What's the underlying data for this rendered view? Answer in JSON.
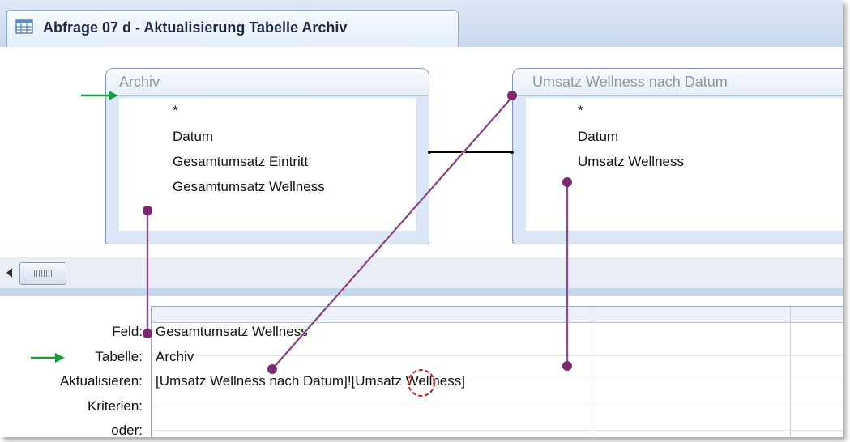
{
  "window": {
    "tab_title": "Abfrage 07 d - Aktualisierung Tabelle Archiv",
    "tab_icon": "query-icon"
  },
  "tables": [
    {
      "title": "Archiv",
      "fields": [
        "*",
        "Datum",
        "Gesamtumsatz Eintritt",
        "Gesamtumsatz Wellness"
      ]
    },
    {
      "title": "Umsatz Wellness nach Datum",
      "fields": [
        "*",
        "Datum",
        "Umsatz Wellness"
      ]
    }
  ],
  "design_grid": {
    "row_labels": [
      "Feld:",
      "Tabelle:",
      "Aktualisieren:",
      "Kriterien:",
      "oder:"
    ],
    "column1": {
      "feld": "Gesamtumsatz Wellness",
      "tabelle": "Archiv",
      "aktualisieren": "[Umsatz Wellness nach Datum]![Umsatz Wellness]",
      "kriterien": "",
      "oder": ""
    }
  },
  "annotations": {
    "arrow_color": "#1a9a3a",
    "connector_color": "#7b2a6e",
    "highlight_color": "#d62020"
  }
}
